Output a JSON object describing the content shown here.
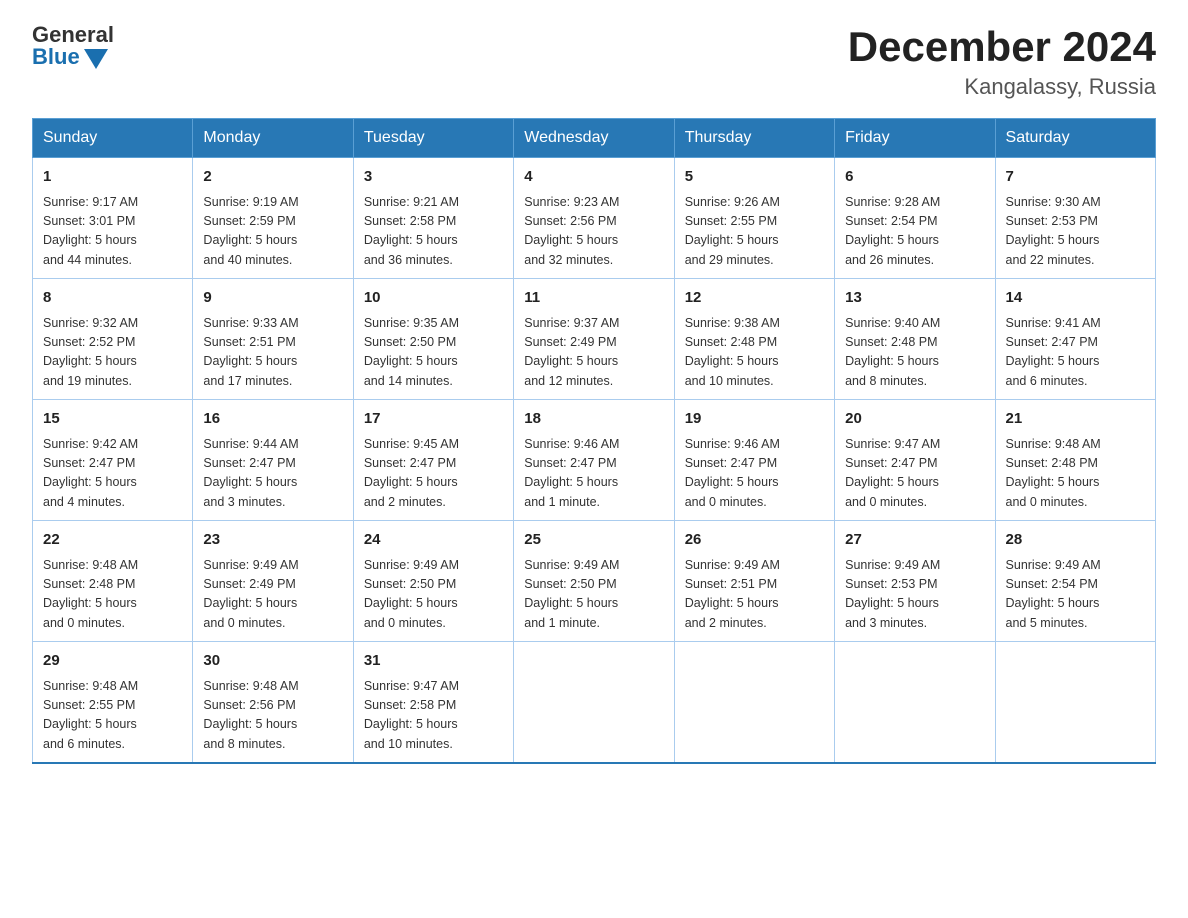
{
  "header": {
    "title": "December 2024",
    "subtitle": "Kangalassy, Russia",
    "logo_general": "General",
    "logo_blue": "Blue"
  },
  "weekdays": [
    "Sunday",
    "Monday",
    "Tuesday",
    "Wednesday",
    "Thursday",
    "Friday",
    "Saturday"
  ],
  "weeks": [
    [
      {
        "day": "1",
        "sunrise": "Sunrise: 9:17 AM",
        "sunset": "Sunset: 3:01 PM",
        "daylight": "Daylight: 5 hours",
        "daylight2": "and 44 minutes."
      },
      {
        "day": "2",
        "sunrise": "Sunrise: 9:19 AM",
        "sunset": "Sunset: 2:59 PM",
        "daylight": "Daylight: 5 hours",
        "daylight2": "and 40 minutes."
      },
      {
        "day": "3",
        "sunrise": "Sunrise: 9:21 AM",
        "sunset": "Sunset: 2:58 PM",
        "daylight": "Daylight: 5 hours",
        "daylight2": "and 36 minutes."
      },
      {
        "day": "4",
        "sunrise": "Sunrise: 9:23 AM",
        "sunset": "Sunset: 2:56 PM",
        "daylight": "Daylight: 5 hours",
        "daylight2": "and 32 minutes."
      },
      {
        "day": "5",
        "sunrise": "Sunrise: 9:26 AM",
        "sunset": "Sunset: 2:55 PM",
        "daylight": "Daylight: 5 hours",
        "daylight2": "and 29 minutes."
      },
      {
        "day": "6",
        "sunrise": "Sunrise: 9:28 AM",
        "sunset": "Sunset: 2:54 PM",
        "daylight": "Daylight: 5 hours",
        "daylight2": "and 26 minutes."
      },
      {
        "day": "7",
        "sunrise": "Sunrise: 9:30 AM",
        "sunset": "Sunset: 2:53 PM",
        "daylight": "Daylight: 5 hours",
        "daylight2": "and 22 minutes."
      }
    ],
    [
      {
        "day": "8",
        "sunrise": "Sunrise: 9:32 AM",
        "sunset": "Sunset: 2:52 PM",
        "daylight": "Daylight: 5 hours",
        "daylight2": "and 19 minutes."
      },
      {
        "day": "9",
        "sunrise": "Sunrise: 9:33 AM",
        "sunset": "Sunset: 2:51 PM",
        "daylight": "Daylight: 5 hours",
        "daylight2": "and 17 minutes."
      },
      {
        "day": "10",
        "sunrise": "Sunrise: 9:35 AM",
        "sunset": "Sunset: 2:50 PM",
        "daylight": "Daylight: 5 hours",
        "daylight2": "and 14 minutes."
      },
      {
        "day": "11",
        "sunrise": "Sunrise: 9:37 AM",
        "sunset": "Sunset: 2:49 PM",
        "daylight": "Daylight: 5 hours",
        "daylight2": "and 12 minutes."
      },
      {
        "day": "12",
        "sunrise": "Sunrise: 9:38 AM",
        "sunset": "Sunset: 2:48 PM",
        "daylight": "Daylight: 5 hours",
        "daylight2": "and 10 minutes."
      },
      {
        "day": "13",
        "sunrise": "Sunrise: 9:40 AM",
        "sunset": "Sunset: 2:48 PM",
        "daylight": "Daylight: 5 hours",
        "daylight2": "and 8 minutes."
      },
      {
        "day": "14",
        "sunrise": "Sunrise: 9:41 AM",
        "sunset": "Sunset: 2:47 PM",
        "daylight": "Daylight: 5 hours",
        "daylight2": "and 6 minutes."
      }
    ],
    [
      {
        "day": "15",
        "sunrise": "Sunrise: 9:42 AM",
        "sunset": "Sunset: 2:47 PM",
        "daylight": "Daylight: 5 hours",
        "daylight2": "and 4 minutes."
      },
      {
        "day": "16",
        "sunrise": "Sunrise: 9:44 AM",
        "sunset": "Sunset: 2:47 PM",
        "daylight": "Daylight: 5 hours",
        "daylight2": "and 3 minutes."
      },
      {
        "day": "17",
        "sunrise": "Sunrise: 9:45 AM",
        "sunset": "Sunset: 2:47 PM",
        "daylight": "Daylight: 5 hours",
        "daylight2": "and 2 minutes."
      },
      {
        "day": "18",
        "sunrise": "Sunrise: 9:46 AM",
        "sunset": "Sunset: 2:47 PM",
        "daylight": "Daylight: 5 hours",
        "daylight2": "and 1 minute."
      },
      {
        "day": "19",
        "sunrise": "Sunrise: 9:46 AM",
        "sunset": "Sunset: 2:47 PM",
        "daylight": "Daylight: 5 hours",
        "daylight2": "and 0 minutes."
      },
      {
        "day": "20",
        "sunrise": "Sunrise: 9:47 AM",
        "sunset": "Sunset: 2:47 PM",
        "daylight": "Daylight: 5 hours",
        "daylight2": "and 0 minutes."
      },
      {
        "day": "21",
        "sunrise": "Sunrise: 9:48 AM",
        "sunset": "Sunset: 2:48 PM",
        "daylight": "Daylight: 5 hours",
        "daylight2": "and 0 minutes."
      }
    ],
    [
      {
        "day": "22",
        "sunrise": "Sunrise: 9:48 AM",
        "sunset": "Sunset: 2:48 PM",
        "daylight": "Daylight: 5 hours",
        "daylight2": "and 0 minutes."
      },
      {
        "day": "23",
        "sunrise": "Sunrise: 9:49 AM",
        "sunset": "Sunset: 2:49 PM",
        "daylight": "Daylight: 5 hours",
        "daylight2": "and 0 minutes."
      },
      {
        "day": "24",
        "sunrise": "Sunrise: 9:49 AM",
        "sunset": "Sunset: 2:50 PM",
        "daylight": "Daylight: 5 hours",
        "daylight2": "and 0 minutes."
      },
      {
        "day": "25",
        "sunrise": "Sunrise: 9:49 AM",
        "sunset": "Sunset: 2:50 PM",
        "daylight": "Daylight: 5 hours",
        "daylight2": "and 1 minute."
      },
      {
        "day": "26",
        "sunrise": "Sunrise: 9:49 AM",
        "sunset": "Sunset: 2:51 PM",
        "daylight": "Daylight: 5 hours",
        "daylight2": "and 2 minutes."
      },
      {
        "day": "27",
        "sunrise": "Sunrise: 9:49 AM",
        "sunset": "Sunset: 2:53 PM",
        "daylight": "Daylight: 5 hours",
        "daylight2": "and 3 minutes."
      },
      {
        "day": "28",
        "sunrise": "Sunrise: 9:49 AM",
        "sunset": "Sunset: 2:54 PM",
        "daylight": "Daylight: 5 hours",
        "daylight2": "and 5 minutes."
      }
    ],
    [
      {
        "day": "29",
        "sunrise": "Sunrise: 9:48 AM",
        "sunset": "Sunset: 2:55 PM",
        "daylight": "Daylight: 5 hours",
        "daylight2": "and 6 minutes."
      },
      {
        "day": "30",
        "sunrise": "Sunrise: 9:48 AM",
        "sunset": "Sunset: 2:56 PM",
        "daylight": "Daylight: 5 hours",
        "daylight2": "and 8 minutes."
      },
      {
        "day": "31",
        "sunrise": "Sunrise: 9:47 AM",
        "sunset": "Sunset: 2:58 PM",
        "daylight": "Daylight: 5 hours",
        "daylight2": "and 10 minutes."
      },
      {
        "day": "",
        "sunrise": "",
        "sunset": "",
        "daylight": "",
        "daylight2": ""
      },
      {
        "day": "",
        "sunrise": "",
        "sunset": "",
        "daylight": "",
        "daylight2": ""
      },
      {
        "day": "",
        "sunrise": "",
        "sunset": "",
        "daylight": "",
        "daylight2": ""
      },
      {
        "day": "",
        "sunrise": "",
        "sunset": "",
        "daylight": "",
        "daylight2": ""
      }
    ]
  ]
}
